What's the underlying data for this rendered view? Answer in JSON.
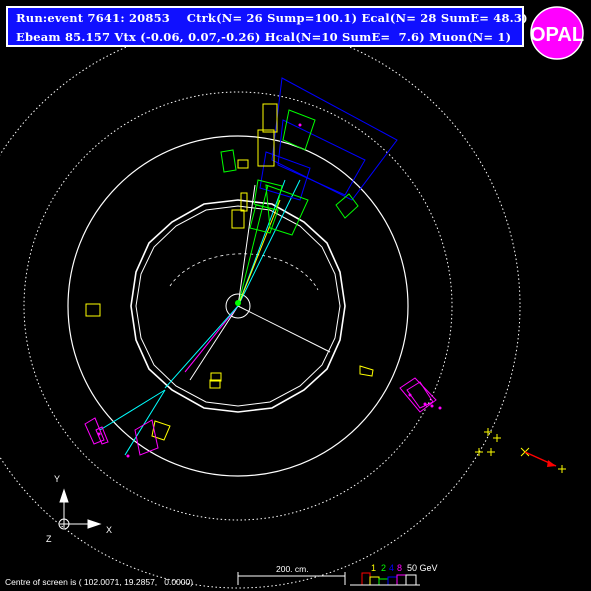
{
  "header": {
    "line1": "Run:event 7641: 20853    Ctrk(N= 26 Sump=100.1) Ecal(N= 28 SumE= 48.3)",
    "line2": "Ebeam 85.157 Vtx (-0.06, 0.07,-0.26) Hcal(N=10 SumE=  7.6) Muon(N= 1)"
  },
  "logo": {
    "text": "OPAL",
    "bg_color": "#ff00ff"
  },
  "footer": {
    "centre_text": "Centre of screen is ( 102.0071, 19.2857,   0.0000)"
  },
  "scale": {
    "label": "200. cm."
  },
  "energy_scale": {
    "v1": "1",
    "v2": "2",
    "v3": "4",
    "v4": "8",
    "unit": "50 GeV"
  },
  "axes": {
    "x": "X",
    "y": "Y",
    "z": "Z"
  },
  "colors": {
    "header_bg": "#1010ff",
    "track": "#ffffff",
    "ecal": "#ffff00",
    "hcal": "#00ff00",
    "muon_chambers": "#0000ff",
    "cyan": "#00ffff",
    "magenta": "#ff00ff",
    "muon_hit": "#ff0000"
  }
}
